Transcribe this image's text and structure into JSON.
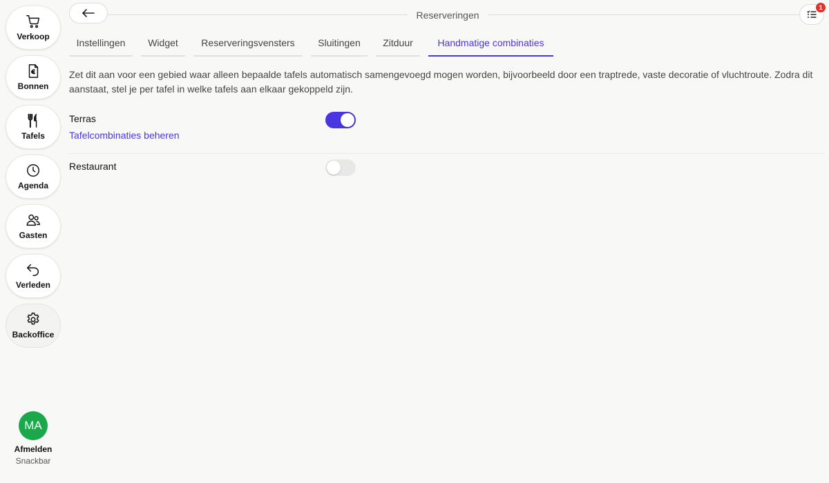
{
  "sidebar": {
    "items": [
      {
        "label": "Verkoop",
        "icon": "cart-icon"
      },
      {
        "label": "Bonnen",
        "icon": "receipt-euro-icon"
      },
      {
        "label": "Tafels",
        "icon": "cutlery-icon"
      },
      {
        "label": "Agenda",
        "icon": "clock-icon"
      },
      {
        "label": "Gasten",
        "icon": "users-icon"
      },
      {
        "label": "Verleden",
        "icon": "undo-arrow-icon"
      },
      {
        "label": "Backoffice",
        "icon": "gear-icon",
        "active": true
      }
    ],
    "user": {
      "initials": "MA",
      "logout_label": "Afmelden",
      "company": "Snackbar",
      "avatar_color": "#1aa84a"
    }
  },
  "header": {
    "title": "Reserveringen",
    "notification_count": "1"
  },
  "tabs": [
    {
      "label": "Instellingen"
    },
    {
      "label": "Widget"
    },
    {
      "label": "Reserveringsvensters"
    },
    {
      "label": "Sluitingen"
    },
    {
      "label": "Zitduur"
    },
    {
      "label": "Handmatige combinaties",
      "active": true
    }
  ],
  "description": "Zet dit aan voor een gebied waar alleen bepaalde tafels automatisch samengevoegd mogen worden, bijvoorbeeld door een traptrede, vaste decoratie of vluchtroute. Zodra dit aanstaat, stel je per tafel in welke tafels aan elkaar gekoppeld zijn.",
  "areas": [
    {
      "name": "Terras",
      "enabled": true,
      "link_label": "Tafelcombinaties beheren"
    },
    {
      "name": "Restaurant",
      "enabled": false
    }
  ],
  "colors": {
    "accent": "#4a36e0",
    "badge": "#e5312a"
  }
}
